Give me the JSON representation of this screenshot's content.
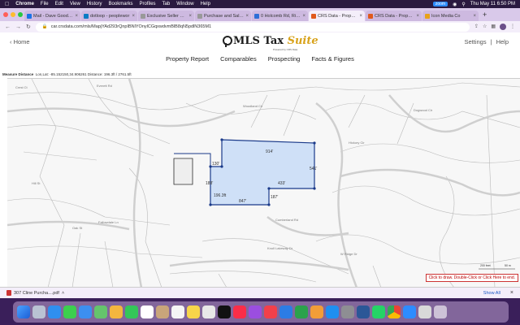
{
  "menubar": {
    "app": "Chrome",
    "items": [
      "File",
      "Edit",
      "View",
      "History",
      "Bookmarks",
      "Profiles",
      "Tab",
      "Window",
      "Help"
    ],
    "zoom": "zoom",
    "clock": "Thu May 11 6:50 PM"
  },
  "tabs": [
    {
      "title": "Mail - Dave Goodyea",
      "active": false
    },
    {
      "title": "dotloop - peoplewor",
      "active": false
    },
    {
      "title": "Exclusive Seller Broke",
      "active": false
    },
    {
      "title": "Purchase and Sale A",
      "active": false
    },
    {
      "title": "0 Holcomb Rd, Ringo",
      "active": false
    },
    {
      "title": "CRS Data - Property",
      "active": true
    },
    {
      "title": "CRS Data - Property",
      "active": false
    },
    {
      "title": "Icon Media Co",
      "active": false
    }
  ],
  "address": {
    "url": "car.crsdata.com/mls/MapjYAd293rQnpIBNlYOnylCGqxwdvmBlB8qN5pdlN365M1"
  },
  "header": {
    "home": "Home",
    "logo_main": "MLS Tax ",
    "logo_accent": "Suite",
    "logo_sub": "Powered by CRS Data",
    "settings": "Settings",
    "sep": "|",
    "help": "Help"
  },
  "nav": [
    "Property Report",
    "Comparables",
    "Prospecting",
    "Facts & Figures"
  ],
  "measure": {
    "label": "Measure Distance",
    "coords": "Lon,Lat:  -85.152150,34.906261   Distance:   196.3ft / 2761.5ft"
  },
  "map": {
    "dimensions": [
      "914'",
      "541'",
      "433'",
      "847'",
      "187'",
      "130'",
      "188'",
      "196.3ft"
    ],
    "streets": [
      "Everett Rd",
      "Hill St",
      "Oak St",
      "Woodland Cir",
      "Fallowdale Ln",
      "Cumberland Rd",
      "Knoll Lakeway Dr",
      "W Ridge Dr",
      "Dogwood Cir",
      "Hickory Cir",
      "Crest Ct"
    ],
    "tooltip": "Click to draw. Double-Click or Click Here to end.",
    "scale_ft": "200 feet",
    "scale_m": "50 m",
    "colors": {
      "parcel_fill": "#cfe0f7",
      "parcel_stroke": "#1a3a8a",
      "lot_lines": "#9a9a9a"
    }
  },
  "download": {
    "file": "307 Cline Purcha....pdf",
    "show_all": "Show All"
  },
  "dock": {
    "apps": [
      "finder",
      "launchpad",
      "safari",
      "messages",
      "mail",
      "maps",
      "photos",
      "facetime",
      "calendar",
      "contacts",
      "reminders",
      "notes",
      "freeform",
      "tv",
      "music",
      "podcasts",
      "news",
      "keynote",
      "numbers",
      "pages",
      "appstore",
      "settings",
      "word",
      "whatsapp",
      "chrome",
      "zoom",
      "preview",
      "trash"
    ]
  }
}
